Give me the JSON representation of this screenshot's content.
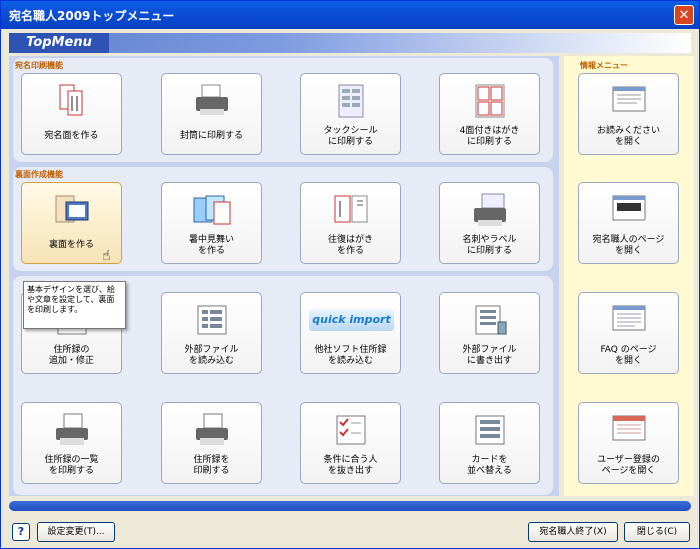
{
  "window": {
    "title": "宛名職人2009トップメニュー",
    "close_glyph": "✕"
  },
  "banner": {
    "title": "TopMenu"
  },
  "sections": {
    "print": "宛名印刷機能",
    "back": "裏面作成機能",
    "info": "情報メニュー"
  },
  "buttons": {
    "atena": "宛名面を作る",
    "envelope": "封筒に印刷する",
    "tack": "タックシール\nに印刷する",
    "fourface": "4面付きはがき\nに印刷する",
    "uramen": "裏面を作る",
    "shochu": "暑中見舞い\nを作る",
    "oufuku": "往復はがき\nを作る",
    "meishi": "名刺やラベル\nに印刷する",
    "jusho_add": "住所録の\n追加・修正",
    "ext_read": "外部ファイル\nを読み込む",
    "other_soft": "他社ソフト住所録\nを読み込む",
    "ext_write": "外部ファイル\nに書き出す",
    "jusho_list": "住所録の一覧\nを印刷する",
    "jusho_print": "住所録を\n印刷する",
    "condition": "条件に合う人\nを抜き出す",
    "sort": "カードを\n並べ替える",
    "readme": "お読みください\nを開く",
    "atena_page": "宛名職人のページ\nを開く",
    "faq": "FAQ のページ\nを開く",
    "user_reg": "ユーザー登録の\nページを開く"
  },
  "tooltip": "基本デザインを選び、絵や文章を設定して、裏面を印刷します。",
  "quick_import": "quick import",
  "footer": {
    "help": "?",
    "settings": "設定変更(T)...",
    "quit": "宛名職人終了(X)",
    "close": "閉じる(C)"
  },
  "icons": [
    "postcard-icon",
    "printer-envelope-icon",
    "label-sheet-icon",
    "four-postcard-icon",
    "card-design-icon",
    "summer-card-icon",
    "reply-card-icon",
    "business-card-icon",
    "address-book-icon",
    "import-file-icon",
    "quick-import-icon",
    "export-file-icon",
    "print-list-icon",
    "print-address-icon",
    "filter-icon",
    "sort-icon",
    "readme-icon",
    "web-page-icon",
    "faq-icon",
    "registration-icon"
  ]
}
